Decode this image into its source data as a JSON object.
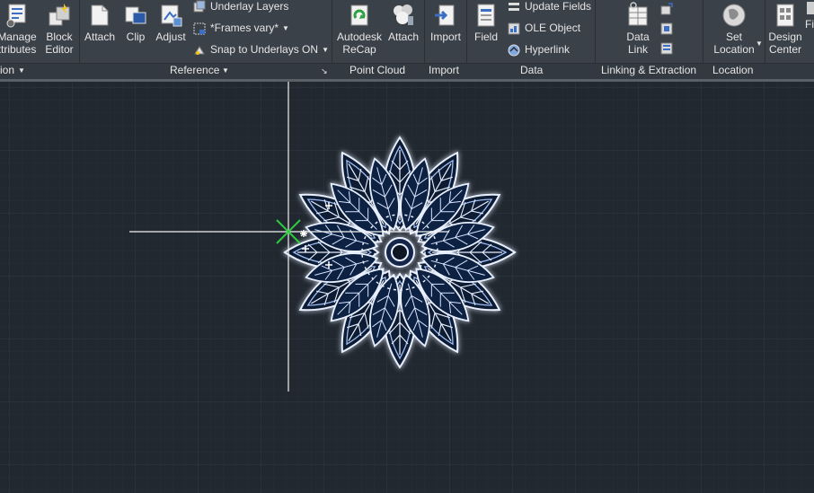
{
  "ribbon": {
    "block_panel": {
      "title_partial": "ion",
      "tools": [
        {
          "label_line1": "Manage",
          "label_line2": "ttributes",
          "icon": "manage-attributes-icon"
        },
        {
          "label_line1": "Block",
          "label_line2": "Editor",
          "icon": "block-editor-icon"
        }
      ]
    },
    "reference_panel": {
      "title": "Reference",
      "tools": [
        {
          "label": "Attach",
          "icon": "attach-icon"
        },
        {
          "label": "Clip",
          "icon": "clip-icon"
        },
        {
          "label": "Adjust",
          "icon": "adjust-icon"
        }
      ],
      "underlay_layers": "Underlay Layers",
      "frames_vary": "*Frames vary*",
      "snap_to_underlays": "Snap to Underlays ON"
    },
    "point_cloud_panel": {
      "title": "Point Cloud",
      "tools": [
        {
          "label_line1": "Autodesk",
          "label_line2": "ReCap",
          "icon": "recap-icon"
        },
        {
          "label": "Attach",
          "icon": "point-cloud-attach-icon"
        }
      ]
    },
    "import_panel": {
      "title": "Import",
      "tools": [
        {
          "label": "Import",
          "icon": "import-icon"
        }
      ]
    },
    "data_panel": {
      "title": "Data",
      "field": "Field",
      "update_fields": "Update Fields",
      "ole_object": "OLE Object",
      "hyperlink": "Hyperlink"
    },
    "linking_panel": {
      "title": "Linking & Extraction",
      "data_link_line1": "Data",
      "data_link_line2": "Link"
    },
    "location_panel": {
      "title": "Location",
      "set_location_line1": "Set",
      "set_location_line2": "Location"
    },
    "content_panel": {
      "design_center_line1": "Design",
      "design_center_line2": "Center",
      "partial_label": "Fi"
    }
  },
  "colors": {
    "ribbon_bg": "#3b4149",
    "canvas_bg": "#212830",
    "mandala_stroke": "#e8f0ff",
    "mandala_glow": "#4a7ee6",
    "crosshair": "#ffffff",
    "ucs_marker": "#2ecc40"
  }
}
